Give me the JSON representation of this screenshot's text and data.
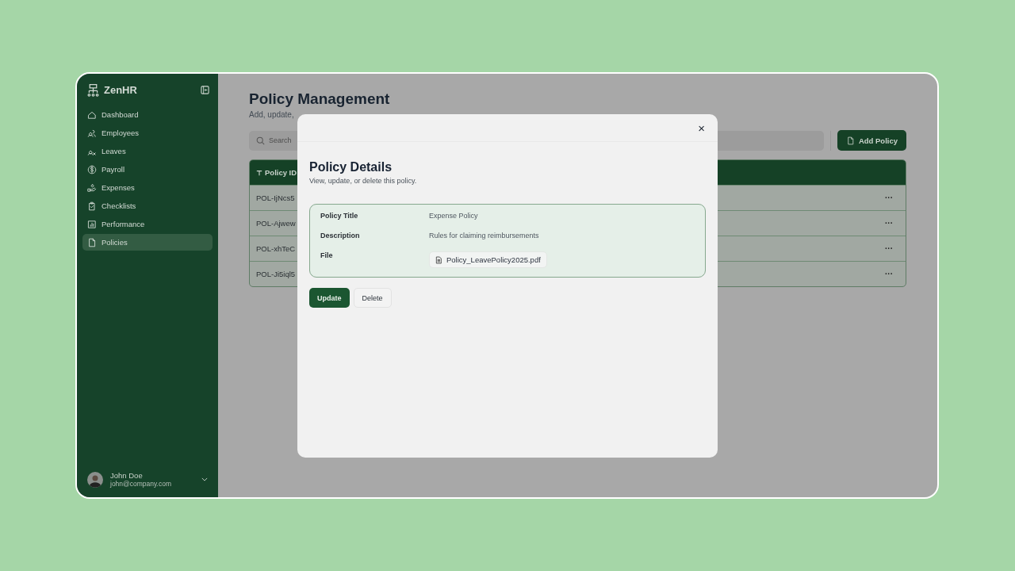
{
  "app": {
    "name": "ZenHR"
  },
  "sidebar": {
    "items": [
      {
        "label": "Dashboard",
        "selected": false
      },
      {
        "label": "Employees",
        "selected": false
      },
      {
        "label": "Leaves",
        "selected": false
      },
      {
        "label": "Payroll",
        "selected": false
      },
      {
        "label": "Expenses",
        "selected": false
      },
      {
        "label": "Checklists",
        "selected": false
      },
      {
        "label": "Performance",
        "selected": false
      },
      {
        "label": "Policies",
        "selected": true
      }
    ]
  },
  "user": {
    "name": "John Doe",
    "email": "john@company.com"
  },
  "page": {
    "title": "Policy Management",
    "subtitle": "Add, update,"
  },
  "search": {
    "placeholder": "Search"
  },
  "add_button": "Add Policy",
  "table": {
    "columns": [
      "Policy ID"
    ],
    "rows": [
      {
        "policy_id": "POL-IjNcs5",
        "action": "···"
      },
      {
        "policy_id": "POL-Ajwew",
        "action": "···"
      },
      {
        "policy_id": "POL-xhTeC",
        "action": "···"
      },
      {
        "policy_id": "POL-Ji5iql5",
        "action": "···"
      }
    ]
  },
  "modal": {
    "close": "×",
    "title": "Policy Details",
    "subtitle": "View, update, or delete this policy.",
    "fields": [
      {
        "label": "Policy Title",
        "value": "Expense Policy",
        "kind": "text"
      },
      {
        "label": "Description",
        "value": "Rules for claiming reimbursements",
        "kind": "text"
      },
      {
        "label": "File",
        "value": "Policy_LeavePolicy2025.pdf",
        "kind": "file"
      }
    ],
    "buttons": [
      {
        "label": "Update",
        "kind": "primary"
      },
      {
        "label": "Delete",
        "kind": "secondary"
      }
    ]
  }
}
